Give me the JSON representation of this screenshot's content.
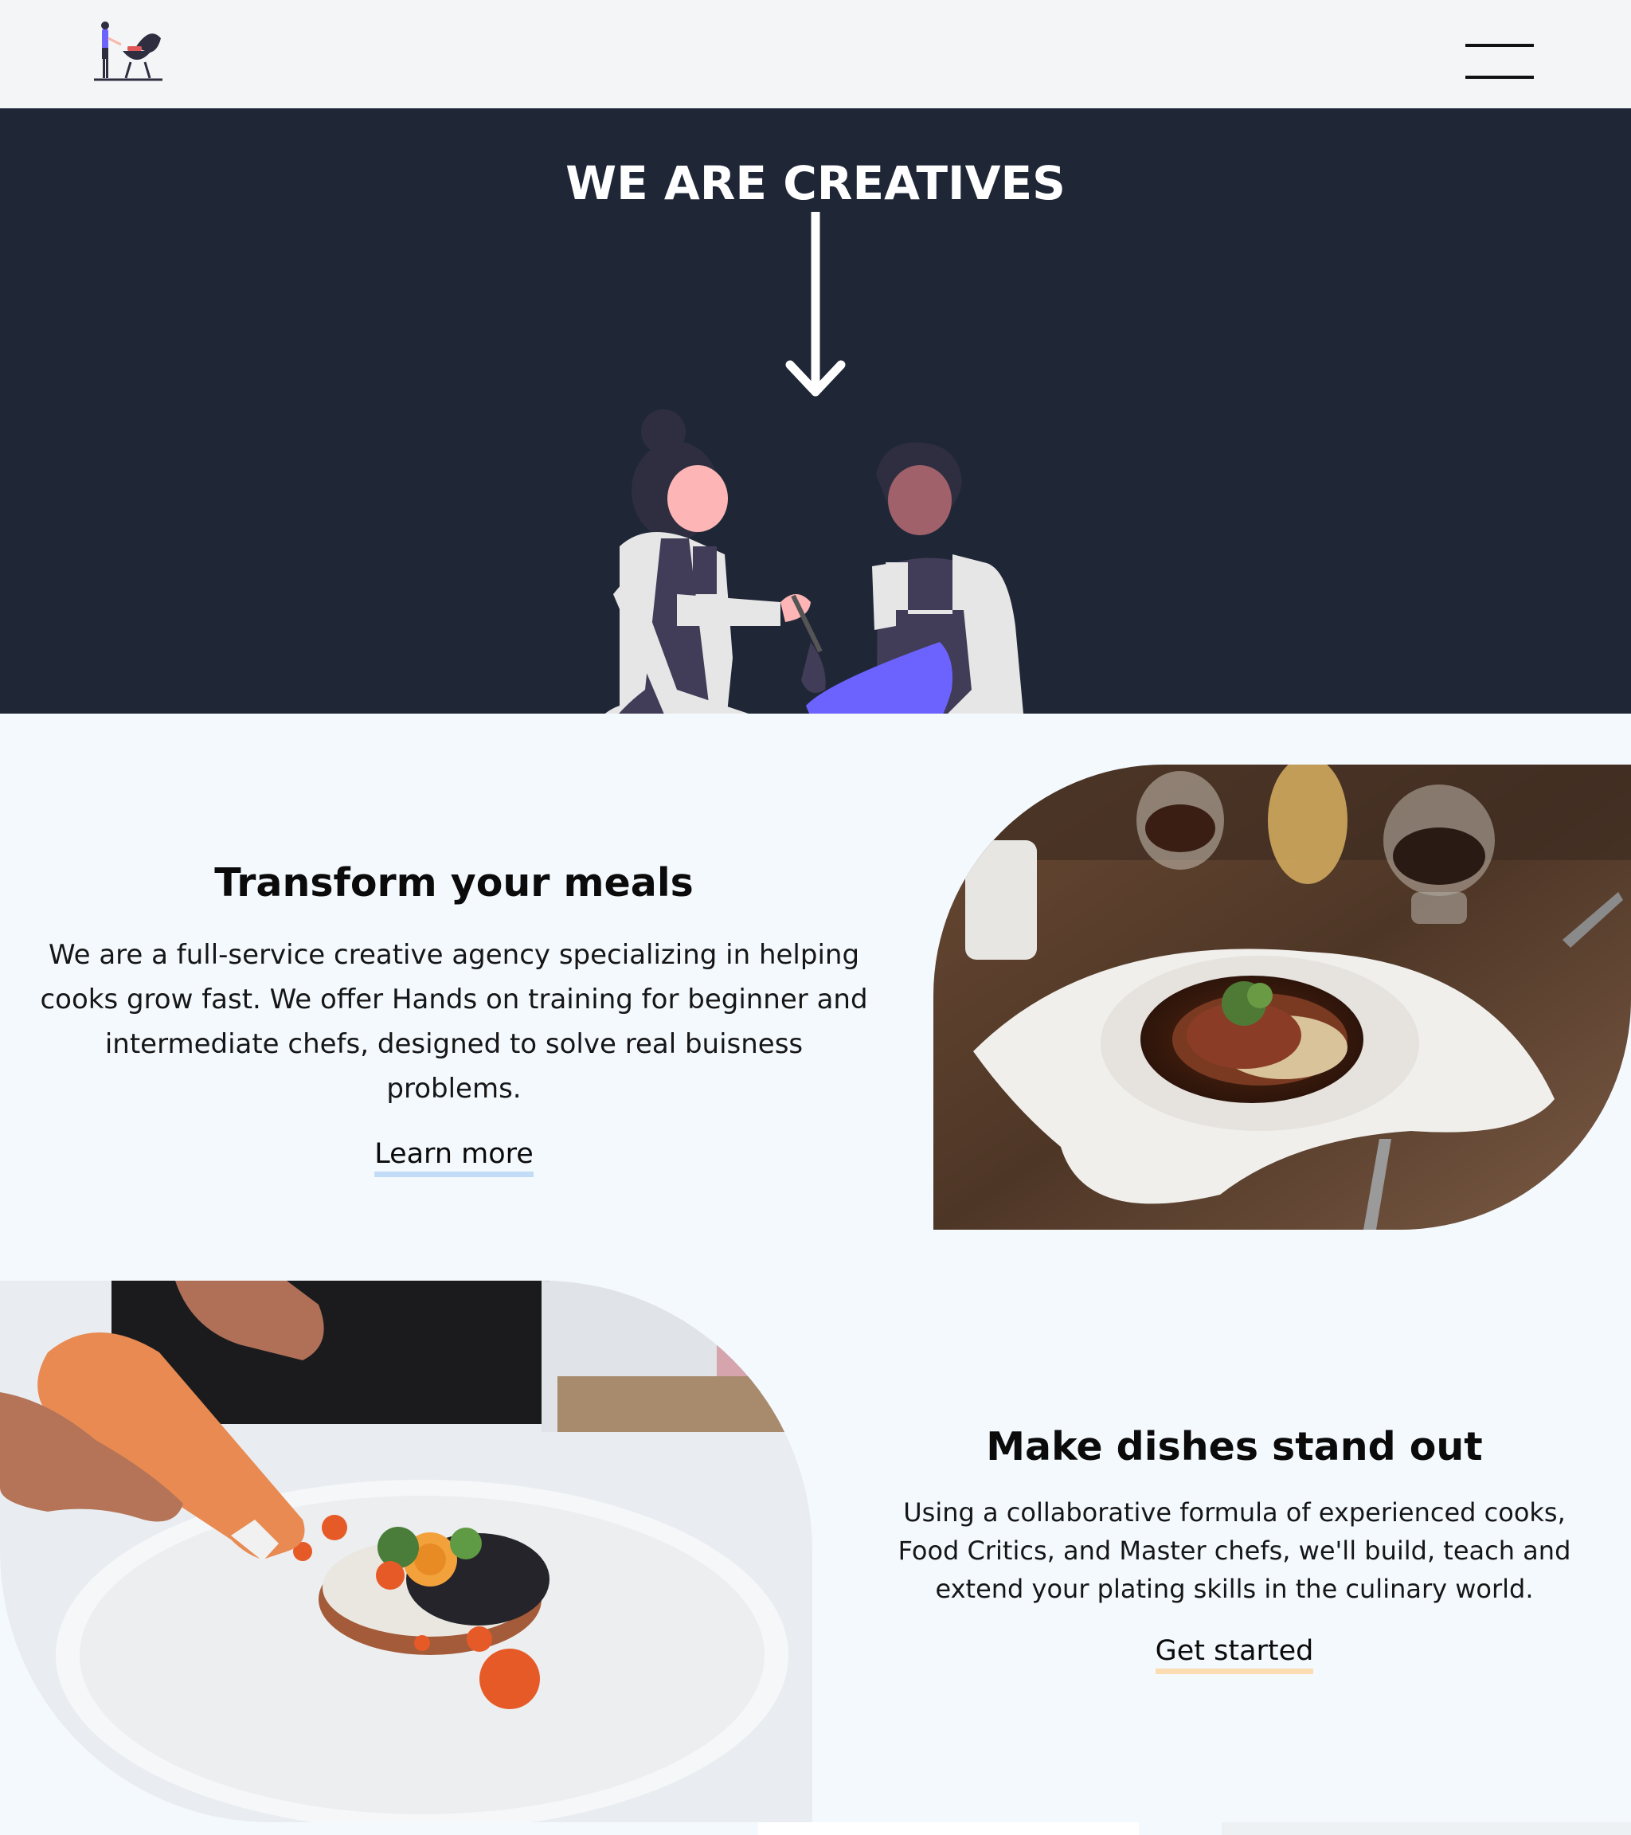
{
  "header": {
    "logo_icon": "grill-cook-logo",
    "menu_icon": "hamburger-menu-icon"
  },
  "hero": {
    "title": "WE ARE CREATIVES",
    "illustration": "two-chefs-mixing-bowl-illustration",
    "arrow_icon": "arrow-down-icon"
  },
  "section1": {
    "title": "Transform your meals",
    "body": "We are a full-service creative agency specializing in helping cooks grow fast. We offer Hands on training for beginner and intermediate chefs, designed to solve real buisness problems.",
    "cta": "Learn more",
    "image": "plated-duck-dish-photo"
  },
  "section2": {
    "title": "Make dishes stand out",
    "body": "Using a collaborative formula of experienced cooks, Food Critics, and Master chefs, we'll build, teach and extend your plating skills in the culinary world.",
    "cta": "Get started",
    "image": "chef-plating-sauce-photo"
  },
  "colors": {
    "hero_bg": "#1f2737",
    "page_bg": "#f4f9fe",
    "nav_bg": "#f4f5f7",
    "accent_purple": "#6c63ff",
    "underline_blue": "#c2dbf7",
    "underline_orange": "#fcdcb2"
  }
}
